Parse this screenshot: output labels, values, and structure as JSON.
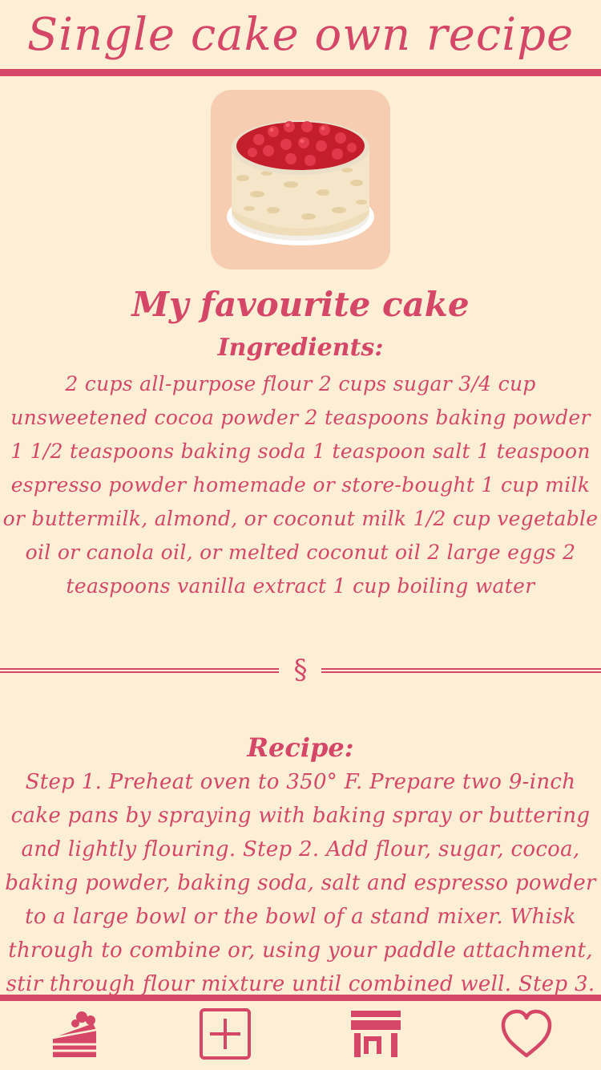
{
  "header": {
    "title": "Single cake own recipe"
  },
  "recipe": {
    "title": "My favourite cake",
    "ingredients_heading": "Ingredients:",
    "ingredients_text": "2 cups all-purpose flour 2 cups sugar 3/4 cup unsweetened cocoa powder 2 teaspoons baking powder 1 1/2 teaspoons baking soda 1 teaspoon salt 1 teaspoon espresso powder homemade or store-bought 1 cup milk or buttermilk, almond, or coconut milk 1/2 cup vegetable oil or canola oil, or melted coconut oil 2 large eggs 2 teaspoons vanilla extract 1 cup boiling water",
    "divider_symbol": "§",
    "recipe_heading": "Recipe:",
    "recipe_text": "Step 1. Preheat oven to 350° F. Prepare two 9-inch cake pans by spraying with baking spray or buttering and lightly flouring. Step 2. Add flour, sugar, cocoa, baking powder, baking soda, salt and espresso powder to a large bowl or the bowl of a stand mixer. Whisk through to combine or, using your paddle attachment, stir through flour mixture until combined well. Step 3."
  },
  "bottom_nav": {
    "items": [
      {
        "icon": "cake-slice-icon"
      },
      {
        "icon": "add-box-icon"
      },
      {
        "icon": "store-icon"
      },
      {
        "icon": "heart-icon"
      }
    ]
  },
  "colors": {
    "accent": "#d54667",
    "background": "#fdefd6",
    "image_tile": "#f6cdb0"
  }
}
